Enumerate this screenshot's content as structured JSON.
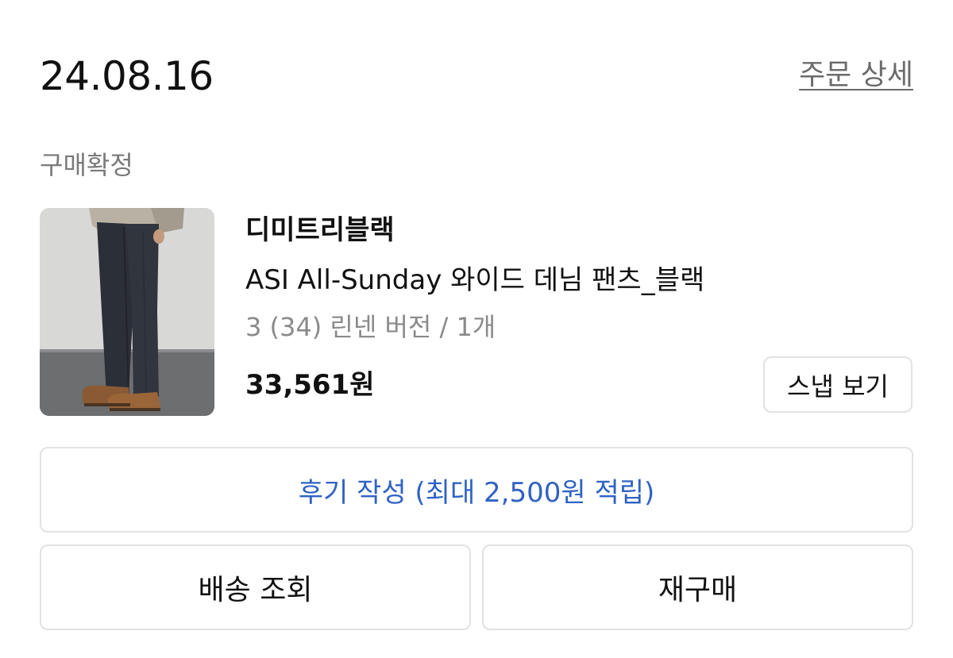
{
  "order": {
    "date": "24.08.16",
    "detail_link": "주문 상세",
    "status": "구매확정"
  },
  "product": {
    "image_icon": "product-photo",
    "brand": "디미트리블랙",
    "name": "ASI All-Sunday 와이드 데님 팬츠_블랙",
    "option": "3 (34) 린넨 버전 / 1개",
    "price": "33,561원",
    "snap_button": "스냅 보기"
  },
  "actions": {
    "review_button": "후기 작성 (최대 2,500원 적립)",
    "delivery_button": "배송 조회",
    "rebuy_button": "재구매"
  },
  "colors": {
    "accent": "#2f62c4",
    "muted_text": "#8a8a8a",
    "border": "#e2e2e2"
  }
}
